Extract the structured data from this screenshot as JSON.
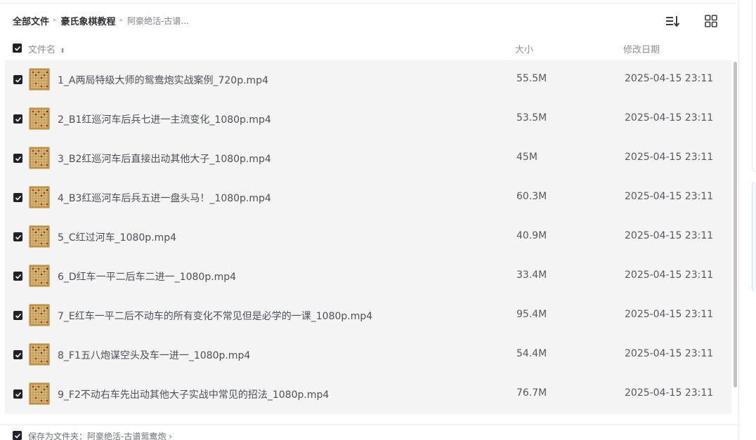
{
  "breadcrumb": {
    "root": "全部文件",
    "folder": "豪氏象棋教程",
    "current": "阿豪绝活-古谱..."
  },
  "toolbar": {
    "sort_icon": "sort-list-icon",
    "view_icon": "grid-view-icon"
  },
  "header": {
    "name": "文件名",
    "size": "大小",
    "modified": "修改日期"
  },
  "files": [
    {
      "name": "1_A两局特级大师的鸳鸯炮实战案例_720p.mp4",
      "size": "55.5M",
      "date": "2025-04-15 23:11"
    },
    {
      "name": "2_B1红巡河车后兵七进一主流变化_1080p.mp4",
      "size": "53.5M",
      "date": "2025-04-15 23:11"
    },
    {
      "name": "3_B2红巡河车后直接出动其他大子_1080p.mp4",
      "size": "45M",
      "date": "2025-04-15 23:11"
    },
    {
      "name": "4_B3红巡河车后兵五进一盘头马！_1080p.mp4",
      "size": "60.3M",
      "date": "2025-04-15 23:11"
    },
    {
      "name": "5_C红过河车_1080p.mp4",
      "size": "40.9M",
      "date": "2025-04-15 23:11"
    },
    {
      "name": "6_D红车一平二后车二进一_1080p.mp4",
      "size": "33.4M",
      "date": "2025-04-15 23:11"
    },
    {
      "name": "7_E红车一平二后不动车的所有变化不常见但是必学的一课_1080p.mp4",
      "size": "95.4M",
      "date": "2025-04-15 23:11"
    },
    {
      "name": "8_F1五八炮谋空头及车一进一_1080p.mp4",
      "size": "54.4M",
      "date": "2025-04-15 23:11"
    },
    {
      "name": "9_F2不动右车先出动其他大子实战中常见的招法_1080p.mp4",
      "size": "76.7M",
      "date": "2025-04-15 23:11"
    }
  ],
  "footer": {
    "save_label": "保存为文件夹：阿豪绝活-古谱鸳鸯炮 ›"
  }
}
